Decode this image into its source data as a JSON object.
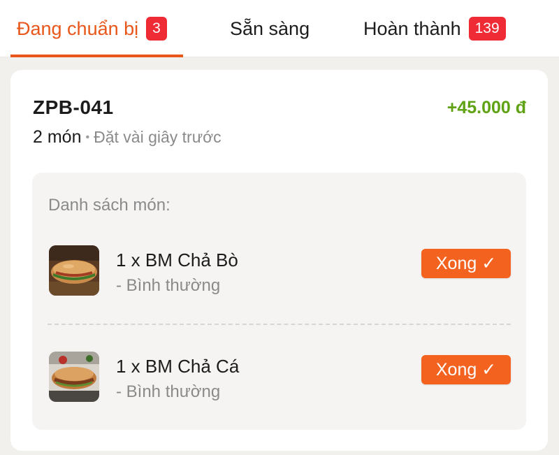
{
  "tabs": [
    {
      "label": "Đang chuẩn bị",
      "badge": "3",
      "active": true
    },
    {
      "label": "Sẵn sàng",
      "badge": null,
      "active": false
    },
    {
      "label": "Hoàn thành",
      "badge": "139",
      "active": false
    }
  ],
  "order": {
    "id": "ZPB-041",
    "total": "+45.000 đ",
    "count": "2 món",
    "separator": "•",
    "time": "Đặt vài giây trước",
    "items_title": "Danh sách món:",
    "items": [
      {
        "name": "1 x BM Chả Bò",
        "note": "- Bình thường",
        "action": "Xong ✓",
        "thumb": "banh-mi-cha-bo-image"
      },
      {
        "name": "1 x BM Chả Cá",
        "note": "- Bình thường",
        "action": "Xong ✓",
        "thumb": "banh-mi-cha-ca-image"
      }
    ]
  },
  "colors": {
    "accent": "#e8561a",
    "button": "#f4621f",
    "badge": "#ef2b36",
    "price": "#5fa214"
  }
}
